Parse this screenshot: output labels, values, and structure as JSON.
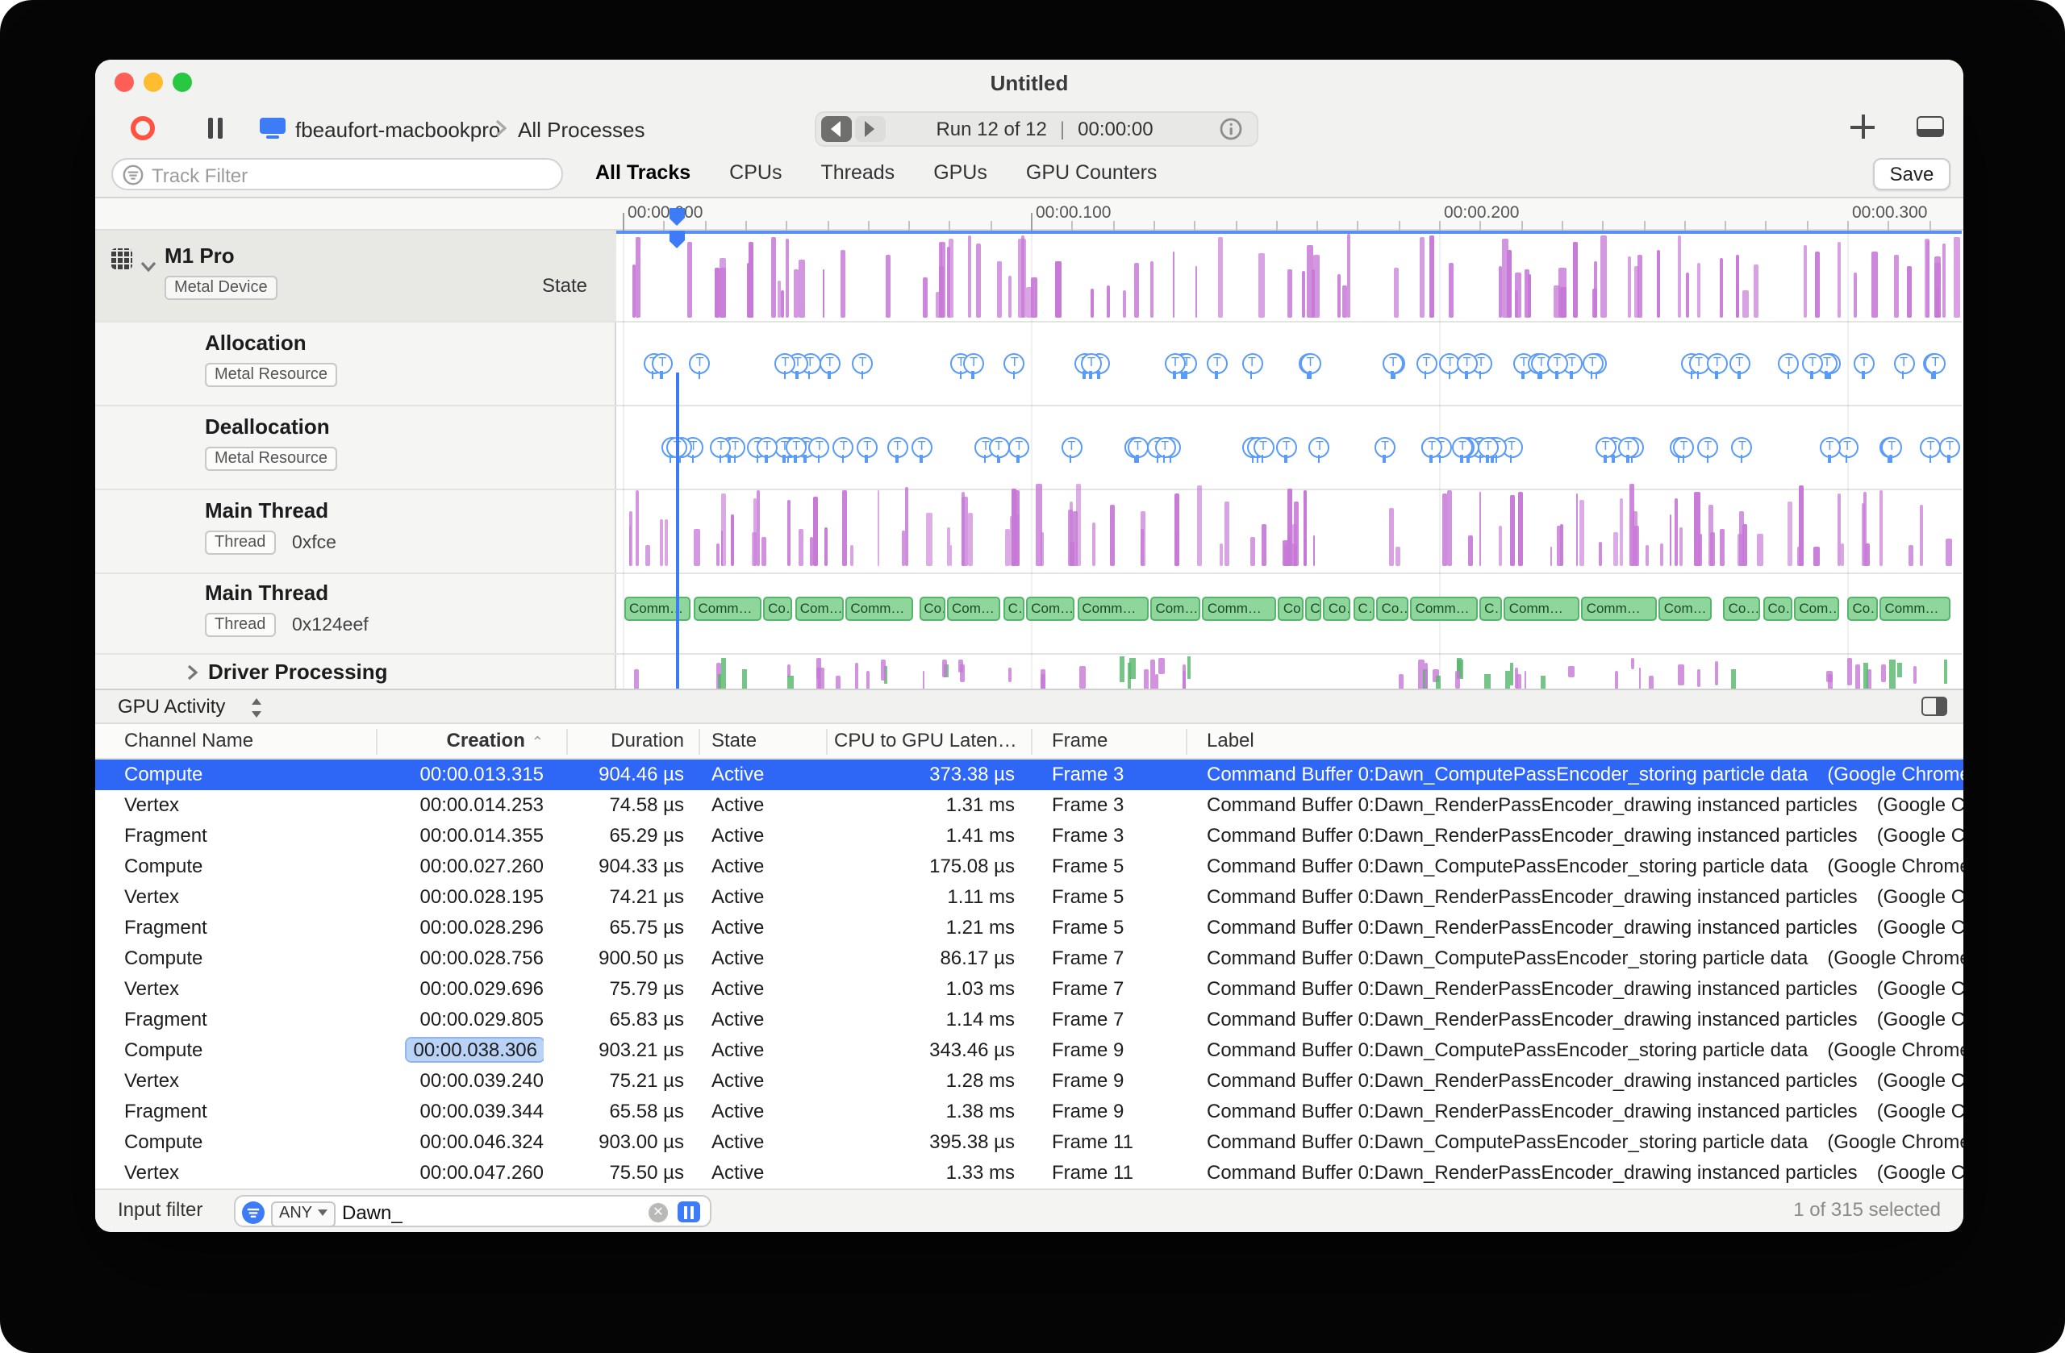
{
  "colors": {
    "accent": "#3d7bf7",
    "row-selected": "#2e66f6",
    "purple": "#c678d6",
    "green-fill": "#8ed69b",
    "green-border": "#55b56a",
    "marker-blue": "#5b9bf8",
    "cell-highlight": "#b9d2f6",
    "traffic-red": "#ff5f57",
    "traffic-yellow": "#febc2e",
    "traffic-green": "#28c840"
  },
  "window": {
    "title": "Untitled"
  },
  "toolbar": {
    "device_name": "fbeaufort-macbookpro",
    "scope": "All Processes",
    "run_label": "Run 12 of 12",
    "run_divider": "|",
    "run_time": "00:00:00"
  },
  "filter_bar": {
    "placeholder": "Track Filter",
    "tabs": [
      {
        "label": "All Tracks",
        "active": true
      },
      {
        "label": "CPUs",
        "active": false
      },
      {
        "label": "Threads",
        "active": false
      },
      {
        "label": "GPUs",
        "active": false
      },
      {
        "label": "GPU Counters",
        "active": false
      }
    ],
    "save_label": "Save"
  },
  "ruler": {
    "ticks": [
      "00:00.000",
      "00:00.100",
      "00:00.200",
      "00:00.300"
    ]
  },
  "marker_glyph": "T",
  "tracks": [
    {
      "name": "M1 Pro",
      "badge": "Metal Device",
      "right_label": "State",
      "type": "state"
    },
    {
      "name": "Allocation",
      "badge": "Metal Resource",
      "type": "markers"
    },
    {
      "name": "Deallocation",
      "badge": "Metal Resource",
      "type": "markers"
    },
    {
      "name": "Main Thread",
      "badge": "Thread",
      "address": "0xfce",
      "type": "bars"
    },
    {
      "name": "Main Thread",
      "badge": "Thread",
      "address": "0x124eef",
      "type": "blocks",
      "block_labels": [
        "C…",
        "Co…",
        "Com…",
        "Comm…"
      ]
    },
    {
      "name": "Driver Processing",
      "type": "collapsed"
    }
  ],
  "detail_pane": {
    "selector_label": "GPU Activity",
    "sort_caret": "⌃",
    "columns": [
      {
        "label": "Channel Name"
      },
      {
        "label": "Creation",
        "sorted": true
      },
      {
        "label": "Duration"
      },
      {
        "label": "State"
      },
      {
        "label": "CPU to GPU Laten…"
      },
      {
        "label": "Frame"
      },
      {
        "label": "Label"
      }
    ],
    "rows": [
      {
        "channel": "Compute",
        "creation": "00:00.013.315",
        "duration": "904.46 µs",
        "state": "Active",
        "latency": "373.38 µs",
        "frame": "Frame 3",
        "label_main": "Command Buffer 0:Dawn_ComputePassEncoder_storing particle data",
        "label_process": "(Google Chrome He",
        "selected": true
      },
      {
        "channel": "Vertex",
        "creation": "00:00.014.253",
        "duration": "74.58 µs",
        "state": "Active",
        "latency": "1.31 ms",
        "frame": "Frame 3",
        "label_main": "Command Buffer 0:Dawn_RenderPassEncoder_drawing instanced particles",
        "label_process": "(Google Chro"
      },
      {
        "channel": "Fragment",
        "creation": "00:00.014.355",
        "duration": "65.29 µs",
        "state": "Active",
        "latency": "1.41 ms",
        "frame": "Frame 3",
        "label_main": "Command Buffer 0:Dawn_RenderPassEncoder_drawing instanced particles",
        "label_process": "(Google Chro"
      },
      {
        "channel": "Compute",
        "creation": "00:00.027.260",
        "duration": "904.33 µs",
        "state": "Active",
        "latency": "175.08 µs",
        "frame": "Frame 5",
        "label_main": "Command Buffer 0:Dawn_ComputePassEncoder_storing particle data",
        "label_process": "(Google Chrome He"
      },
      {
        "channel": "Vertex",
        "creation": "00:00.028.195",
        "duration": "74.21 µs",
        "state": "Active",
        "latency": "1.11 ms",
        "frame": "Frame 5",
        "label_main": "Command Buffer 0:Dawn_RenderPassEncoder_drawing instanced particles",
        "label_process": "(Google Chro"
      },
      {
        "channel": "Fragment",
        "creation": "00:00.028.296",
        "duration": "65.75 µs",
        "state": "Active",
        "latency": "1.21 ms",
        "frame": "Frame 5",
        "label_main": "Command Buffer 0:Dawn_RenderPassEncoder_drawing instanced particles",
        "label_process": "(Google Chro"
      },
      {
        "channel": "Compute",
        "creation": "00:00.028.756",
        "duration": "900.50 µs",
        "state": "Active",
        "latency": "86.17 µs",
        "frame": "Frame 7",
        "label_main": "Command Buffer 0:Dawn_ComputePassEncoder_storing particle data",
        "label_process": "(Google Chrome He"
      },
      {
        "channel": "Vertex",
        "creation": "00:00.029.696",
        "duration": "75.79 µs",
        "state": "Active",
        "latency": "1.03 ms",
        "frame": "Frame 7",
        "label_main": "Command Buffer 0:Dawn_RenderPassEncoder_drawing instanced particles",
        "label_process": "(Google Chro"
      },
      {
        "channel": "Fragment",
        "creation": "00:00.029.805",
        "duration": "65.83 µs",
        "state": "Active",
        "latency": "1.14 ms",
        "frame": "Frame 7",
        "label_main": "Command Buffer 0:Dawn_RenderPassEncoder_drawing instanced particles",
        "label_process": "(Google Chro"
      },
      {
        "channel": "Compute",
        "creation": "00:00.038.306",
        "duration": "903.21 µs",
        "state": "Active",
        "latency": "343.46 µs",
        "frame": "Frame 9",
        "label_main": "Command Buffer 0:Dawn_ComputePassEncoder_storing particle data",
        "label_process": "(Google Chrome He",
        "creation_highlighted": true
      },
      {
        "channel": "Vertex",
        "creation": "00:00.039.240",
        "duration": "75.21 µs",
        "state": "Active",
        "latency": "1.28 ms",
        "frame": "Frame 9",
        "label_main": "Command Buffer 0:Dawn_RenderPassEncoder_drawing instanced particles",
        "label_process": "(Google Chro"
      },
      {
        "channel": "Fragment",
        "creation": "00:00.039.344",
        "duration": "65.58 µs",
        "state": "Active",
        "latency": "1.38 ms",
        "frame": "Frame 9",
        "label_main": "Command Buffer 0:Dawn_RenderPassEncoder_drawing instanced particles",
        "label_process": "(Google Chro"
      },
      {
        "channel": "Compute",
        "creation": "00:00.046.324",
        "duration": "903.00 µs",
        "state": "Active",
        "latency": "395.38 µs",
        "frame": "Frame 11",
        "label_main": "Command Buffer 0:Dawn_ComputePassEncoder_storing particle data",
        "label_process": "(Google Chrome He"
      },
      {
        "channel": "Vertex",
        "creation": "00:00.047.260",
        "duration": "75.50 µs",
        "state": "Active",
        "latency": "1.33 ms",
        "frame": "Frame 11",
        "label_main": "Command Buffer 0:Dawn_RenderPassEncoder_drawing instanced particles",
        "label_process": "(Google Chro"
      }
    ],
    "footer": {
      "label": "Input filter",
      "match_mode": "ANY",
      "query": "Dawn_",
      "clear_glyph": "✕",
      "selection": "1 of 315 selected"
    }
  }
}
